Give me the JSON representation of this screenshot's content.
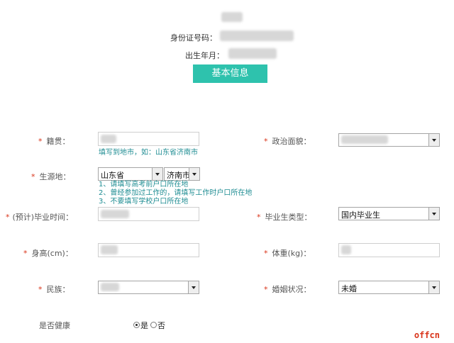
{
  "header": {
    "id_label": "身份证号码：",
    "birth_label": "出生年月：",
    "basic_info_button": "基本信息"
  },
  "form": {
    "native_place": {
      "label": "籍贯：",
      "hint": "填写到地市，如：山东省济南市"
    },
    "political_status": {
      "label": "政治面貌："
    },
    "origin": {
      "label": "生源地：",
      "province": "山东省",
      "city": "济南市",
      "hints": [
        "1、请填写高考前户口所在地",
        "2、曾经参加过工作的，请填写工作时户口所在地",
        "3、不要填写学校户口所在地"
      ]
    },
    "graduation_time": {
      "label": "(预计)毕业时间："
    },
    "graduate_type": {
      "label": "毕业生类型：",
      "value": "国内毕业生"
    },
    "height": {
      "label": "身高(cm)："
    },
    "weight": {
      "label": "体重(kg)："
    },
    "ethnicity": {
      "label": "民族："
    },
    "marital_status": {
      "label": "婚姻状况：",
      "value": "未婚"
    },
    "health": {
      "label": "是否健康",
      "yes": "是",
      "no": "否",
      "selected": "yes"
    }
  },
  "required_mark": "*",
  "watermark": "offcn"
}
